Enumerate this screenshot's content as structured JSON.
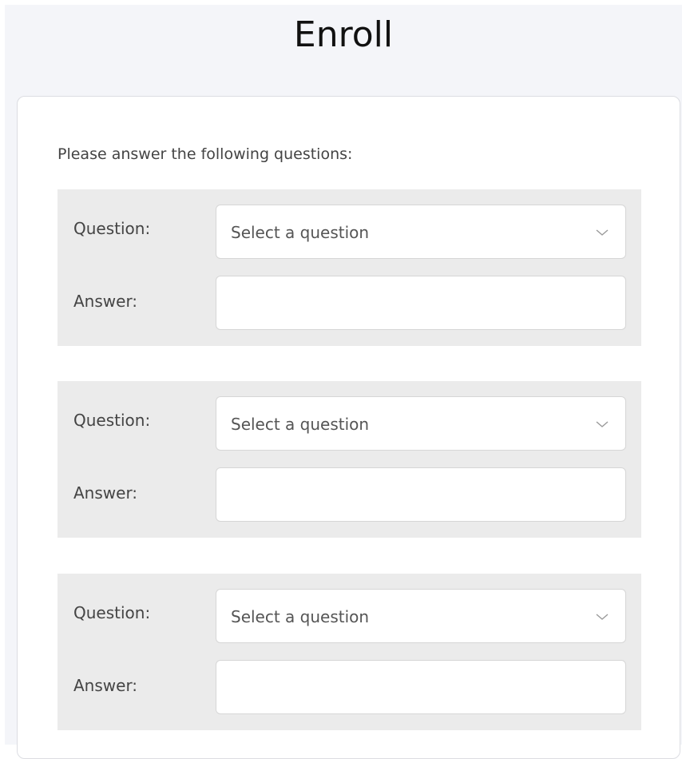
{
  "page": {
    "title": "Enroll"
  },
  "form": {
    "instructions": "Please answer the following questions:",
    "blocks": [
      {
        "question_label": "Question:",
        "select_value": "Select a question",
        "answer_label": "Answer:",
        "answer_value": ""
      },
      {
        "question_label": "Question:",
        "select_value": "Select a question",
        "answer_label": "Answer:",
        "answer_value": ""
      },
      {
        "question_label": "Question:",
        "select_value": "Select a question",
        "answer_label": "Answer:",
        "answer_value": ""
      }
    ]
  },
  "icons": {
    "dropdown": "chevron-down-icon"
  },
  "colors": {
    "page_background": "#f4f5f9",
    "block_background": "#ebebeb",
    "card_background": "#ffffff"
  }
}
